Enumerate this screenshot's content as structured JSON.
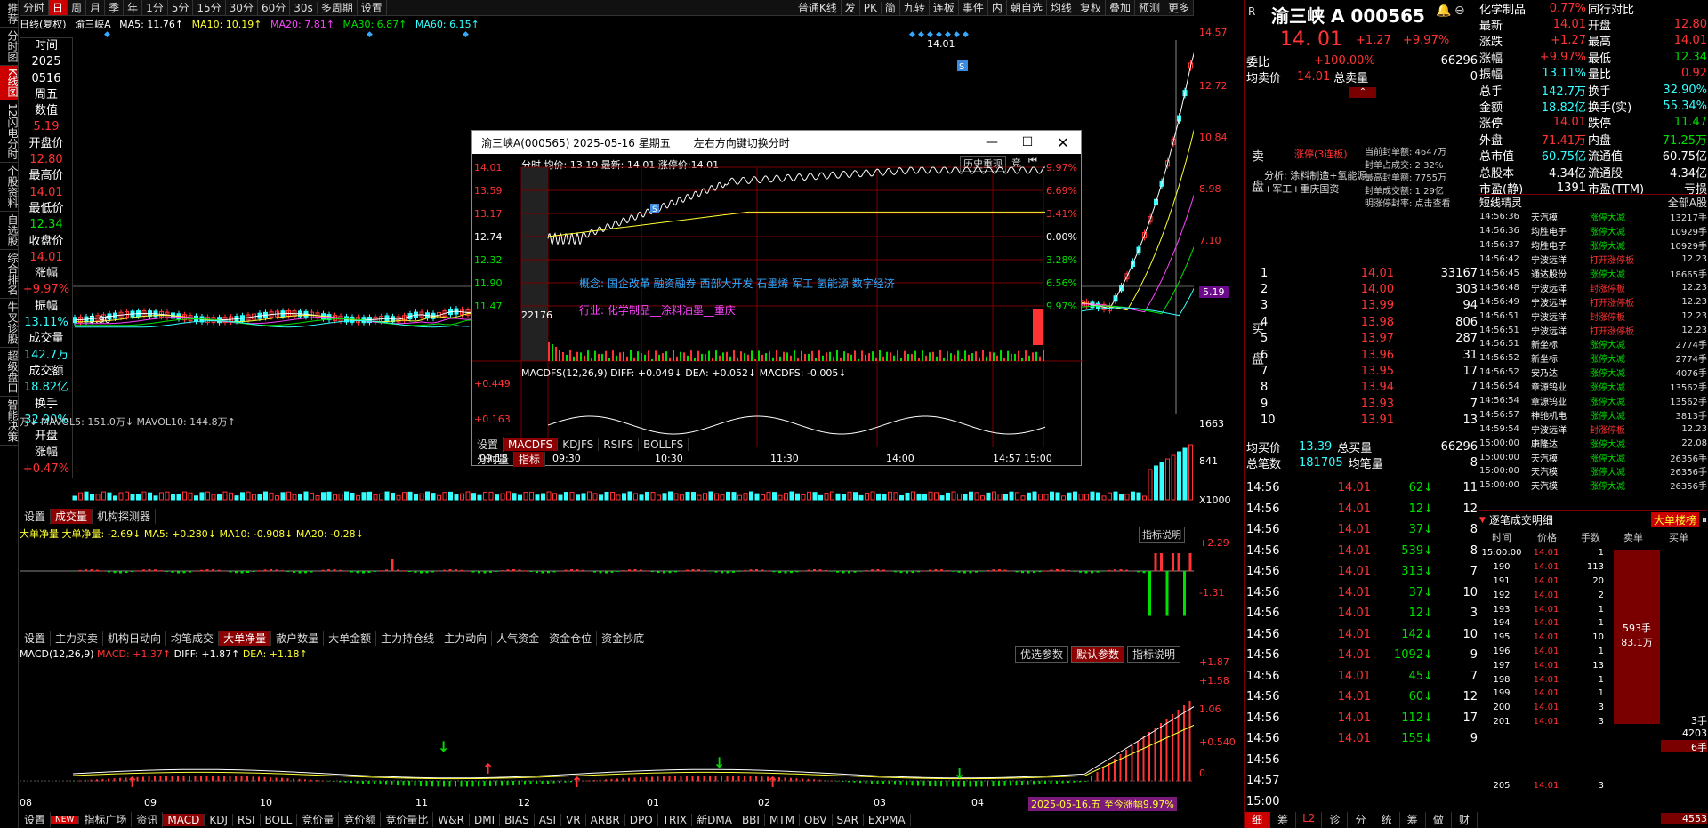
{
  "nav_left": [
    "推荐",
    "分时图",
    "K线图",
    "12闪电分时",
    "个股资料",
    "自选股",
    "综合排名",
    "牛叉诊股",
    "超级盘口",
    "智能决策"
  ],
  "toolbar": {
    "items": [
      "分时",
      "日",
      "周",
      "月",
      "季",
      "年",
      "1分",
      "5分",
      "15分",
      "30分",
      "60分",
      "30s",
      "多周期",
      "设置"
    ],
    "active": "日",
    "right": [
      "普通K线",
      "发",
      "PK",
      "简",
      "九转",
      "连板",
      "事件",
      "内",
      "朝自选",
      "均线",
      "复权",
      "叠加",
      "预测",
      "更多"
    ]
  },
  "ma": {
    "label": "日线(复权)",
    "name": "渝三峡A",
    "ma5": "MA5: 11.76↑",
    "ma10": "MA10: 10.19↑",
    "ma20": "MA20: 7.81↑",
    "ma30": "MA30: 6.87↑",
    "ma60": "MA60: 6.15↑"
  },
  "info": [
    [
      "时间",
      "white"
    ],
    [
      "2025",
      "white"
    ],
    [
      "0516",
      "white"
    ],
    [
      "周五",
      "white"
    ],
    [
      "数值",
      "white"
    ],
    [
      "5.19",
      "red"
    ],
    [
      "开盘价",
      "white"
    ],
    [
      "12.80",
      "red"
    ],
    [
      "最高价",
      "white"
    ],
    [
      "14.01",
      "red"
    ],
    [
      "最低价",
      "white"
    ],
    [
      "12.34",
      "green"
    ],
    [
      "收盘价",
      "white"
    ],
    [
      "14.01",
      "red"
    ],
    [
      "涨幅",
      "white"
    ],
    [
      "+9.97%",
      "red"
    ],
    [
      "振幅",
      "white"
    ],
    [
      "13.11%",
      "cyan"
    ],
    [
      "成交量",
      "white"
    ],
    [
      "142.7万",
      "cyan"
    ],
    [
      "成交额",
      "white"
    ],
    [
      "18.82亿",
      "cyan"
    ],
    [
      "换手",
      "white"
    ],
    [
      "32.90%",
      "cyan"
    ],
    [
      "开盘",
      "white"
    ],
    [
      "涨幅",
      "white"
    ],
    [
      "+0.47%",
      "red"
    ]
  ],
  "kaxis": [
    "14.57",
    "12.72",
    "10.84",
    "8.98",
    "7.10",
    "5.19"
  ],
  "kaxis_hl": "5.19",
  "khigh": "14.01",
  "klow": "3.90",
  "vol": {
    "label": "万↓ MAVOL5: 151.0万↓ MAVOL10: 144.8万↑",
    "axis": [
      "1663",
      "841",
      "X1000"
    ],
    "tabs": [
      "设置",
      "成交量",
      "机构探测器"
    ]
  },
  "dd": {
    "label": "大单净量 大单净量: -2.69↓ MA5: +0.280↓ MA10: -0.908↓ MA20: -0.28↓",
    "axis": [
      "+2.29",
      "-1.31"
    ],
    "help": "指标说明",
    "tabs": [
      "设置",
      "主力买卖",
      "机构日动向",
      "均笔成交",
      "大单净量",
      "散户数量",
      "大单金额",
      "主力持仓线",
      "主力动向",
      "人气资金",
      "资金仓位",
      "资金抄底"
    ]
  },
  "macd": {
    "label": "MACD(12,26,9)",
    "v": "MACD: +1.37↑",
    "diff": "DIFF: +1.87↑",
    "dea": "DEA: +1.18↑",
    "buttons": [
      "优选参数",
      "默认参数",
      "指标说明"
    ],
    "axis": [
      "+1.87",
      "+1.58",
      "1.06",
      "+0.540",
      "0"
    ],
    "xaxis": [
      "08",
      "09",
      "10",
      "11",
      "12",
      "01",
      "02",
      "03",
      "04"
    ],
    "tag": "2025-05-16,五 至今涨幅9.97%",
    "tabs": [
      "设置",
      "NEW",
      "指标广场",
      "资讯",
      "MACD",
      "KDJ",
      "RSI",
      "BOLL",
      "竞价量",
      "竞价额",
      "竞价量比",
      "W&R",
      "DMI",
      "BIAS",
      "ASI",
      "VR",
      "ARBR",
      "DPO",
      "TRIX",
      "新DMA",
      "BBI",
      "MTM",
      "OBV",
      "SAR",
      "EXPMA"
    ]
  },
  "popup": {
    "title": "渝三峡A(000565) 2025-05-16 星期五",
    "hint": "左右方向键切换分时",
    "header": "分时 均价: 13.19 最新: 14.01 涨停价:14.01",
    "hist": "历史重现",
    "jing": "竞",
    "laxis": [
      "14.01",
      "13.59",
      "13.17",
      "12.74",
      "12.32",
      "11.90",
      "11.47"
    ],
    "raxis": [
      "9.97%",
      "6.69%",
      "3.41%",
      "0.00%",
      "3.28%",
      "6.56%",
      "9.97%"
    ],
    "concept": "概念: 国企改革 融资融券 西部大开发 石墨烯 军工 氢能源 数字经济",
    "industry": "行业: 化学制品__涂料油墨__重庆",
    "volmax": "22176",
    "macdlabel": "MACDFS(12,26,9) DIFF: +0.049↓ DEA: +0.052↓ MACDFS: -0.005↓",
    "maxis": [
      "+0.449",
      "+0.163"
    ],
    "xaxis": [
      "09:15",
      "09:30",
      "10:30",
      "11:30",
      "14:00",
      "14:57",
      "15:00"
    ],
    "tabs": [
      "设置",
      "MACDFS",
      "KDJFS",
      "RSIFS",
      "BOLLFS"
    ],
    "tabs2": [
      "分时量",
      "指标"
    ]
  },
  "stock": {
    "name": "渝三峡 A",
    "code": "000565",
    "price": "14. 01",
    "chg": "+1.27",
    "pct": "+9.97%",
    "weibi": "委比",
    "weibi_v": "+100.00%",
    "weicha": "66296",
    "avg": "均卖价",
    "avg_v": "14.01",
    "zong": "总卖量",
    "zong_v": "0"
  },
  "limit": {
    "title": "涨停(3连板)",
    "analysis": "分析: 涂料制造+氢能源+军工+重庆国资",
    "stats": [
      "当前封单额: 4647万",
      "封单占成交: 2.32%",
      "最高封单额: 7755万",
      "封单成交额: 1.29亿",
      "明涨停封率: 点击查看"
    ]
  },
  "quote": [
    [
      "化学制品",
      "0.77%",
      "同行对比",
      ""
    ],
    [
      "最新",
      "14.01",
      "开盘",
      "12.80"
    ],
    [
      "涨跌",
      "+1.27",
      "最高",
      "14.01"
    ],
    [
      "涨幅",
      "+9.97%",
      "最低",
      "12.34"
    ],
    [
      "振幅",
      "13.11%",
      "量比",
      "0.92"
    ],
    [
      "总手",
      "142.7万",
      "换手",
      "32.90%"
    ],
    [
      "金额",
      "18.82亿",
      "换手(实)",
      "55.34%"
    ],
    [
      "涨停",
      "14.01",
      "跌停",
      "11.47"
    ],
    [
      "外盘",
      "71.41万",
      "内盘",
      "71.25万"
    ],
    [
      "总市值",
      "60.75亿",
      "流通值",
      "60.75亿"
    ],
    [
      "总股本",
      "4.34亿",
      "流通股",
      "4.34亿"
    ],
    [
      "市盈(静)",
      "1391",
      "市盈(TTM)",
      "亏损"
    ]
  ],
  "buy": [
    [
      "1",
      "14.01",
      "33167"
    ],
    [
      "2",
      "14.00",
      "303"
    ],
    [
      "3",
      "13.99",
      "94"
    ],
    [
      "4",
      "13.98",
      "806"
    ],
    [
      "5",
      "13.97",
      "287"
    ],
    [
      "6",
      "13.96",
      "31"
    ],
    [
      "7",
      "13.95",
      "17"
    ],
    [
      "8",
      "13.94",
      "7"
    ],
    [
      "9",
      "13.93",
      "7"
    ],
    [
      "10",
      "13.91",
      "13"
    ]
  ],
  "buysum": {
    "a": "均买价",
    "av": "13.39",
    "b": "总买量",
    "bv": "66296",
    "c": "总笔数",
    "cv": "181705",
    "d": "均笔量",
    "dv": "8"
  },
  "ticks": [
    [
      "14:56",
      "14.01",
      "62",
      "11"
    ],
    [
      "14:56",
      "14.01",
      "12",
      "12"
    ],
    [
      "14:56",
      "14.01",
      "37",
      "8"
    ],
    [
      "14:56",
      "14.01",
      "539",
      "8"
    ],
    [
      "14:56",
      "14.01",
      "313",
      "7"
    ],
    [
      "14:56",
      "14.01",
      "37",
      "10"
    ],
    [
      "14:56",
      "14.01",
      "12",
      "3"
    ],
    [
      "14:56",
      "14.01",
      "142",
      "10"
    ],
    [
      "14:56",
      "14.01",
      "1092",
      "9"
    ],
    [
      "14:56",
      "14.01",
      "45",
      "7"
    ],
    [
      "14:56",
      "14.01",
      "60",
      "12"
    ],
    [
      "14:56",
      "14.01",
      "112",
      "17"
    ],
    [
      "14:56",
      "14.01",
      "155",
      "9"
    ],
    [
      "14:56",
      "",
      "",
      ""
    ],
    [
      "14:57",
      "",
      "",
      ""
    ],
    [
      "15:00",
      "",
      "",
      ""
    ]
  ],
  "short_title": "短线精灵",
  "short_all": "全部A股",
  "short": [
    [
      "14:56:36",
      "天汽模",
      "涨停大减",
      "13217手"
    ],
    [
      "14:56:36",
      "均胜电子",
      "涨停大减",
      "10929手"
    ],
    [
      "14:56:37",
      "均胜电子",
      "涨停大减",
      "10929手"
    ],
    [
      "14:56:42",
      "宁波远洋",
      "打开涨停板",
      "12.23"
    ],
    [
      "14:56:45",
      "通达股份",
      "涨停大减",
      "18665手"
    ],
    [
      "14:56:48",
      "宁波远洋",
      "封涨停板",
      "12.23"
    ],
    [
      "14:56:49",
      "宁波远洋",
      "打开涨停板",
      "12.23"
    ],
    [
      "14:56:51",
      "宁波远洋",
      "封涨停板",
      "12.23"
    ],
    [
      "14:56:51",
      "宁波远洋",
      "打开涨停板",
      "12.23"
    ],
    [
      "14:56:51",
      "新坐标",
      "涨停大减",
      "2774手"
    ],
    [
      "14:56:52",
      "新坐标",
      "涨停大减",
      "2774手"
    ],
    [
      "14:56:52",
      "安乃达",
      "涨停大减",
      "4076手"
    ],
    [
      "14:56:54",
      "章源钨业",
      "涨停大减",
      "13562手"
    ],
    [
      "14:56:54",
      "章源钨业",
      "涨停大减",
      "13562手"
    ],
    [
      "14:56:57",
      "神驰机电",
      "涨停大减",
      "3813手"
    ],
    [
      "14:59:54",
      "宁波远洋",
      "封涨停板",
      "12.23"
    ],
    [
      "15:00:00",
      "康隆达",
      "涨停大减",
      "22.08"
    ],
    [
      "15:00:00",
      "天汽模",
      "涨停大减",
      "26356手"
    ],
    [
      "15:00:00",
      "天汽模",
      "涨停大减",
      "26356手"
    ],
    [
      "15:00:00",
      "天汽模",
      "涨停大减",
      "26356手"
    ]
  ],
  "detail_title": "逐笔成交明细",
  "detail_btn": "大单楼榜",
  "detail_cols": [
    "时间",
    "价格",
    "手数",
    "卖单",
    "买单"
  ],
  "detail": [
    [
      "15:00:00",
      "14.01",
      "1"
    ],
    [
      "190",
      "14.01",
      "113"
    ],
    [
      "191",
      "14.01",
      "20"
    ],
    [
      "192",
      "14.01",
      "2"
    ],
    [
      "193",
      "14.01",
      "1"
    ],
    [
      "194",
      "14.01",
      "1"
    ],
    [
      "195",
      "14.01",
      "10"
    ],
    [
      "196",
      "14.01",
      "1"
    ],
    [
      "197",
      "14.01",
      "13"
    ],
    [
      "198",
      "14.01",
      "1"
    ],
    [
      "199",
      "14.01",
      "1"
    ],
    [
      "200",
      "14.01",
      "3"
    ],
    [
      "201",
      "14.01",
      "3"
    ],
    [
      "205",
      "14.01",
      "3"
    ]
  ],
  "sellbox": "593手 83.1万",
  "buybox": [
    "3手",
    "4203",
    "6手",
    "4553"
  ],
  "bottomtabs": [
    "细",
    "筹",
    "L2",
    "诊",
    "分",
    "统",
    "筹",
    "做",
    "财"
  ]
}
